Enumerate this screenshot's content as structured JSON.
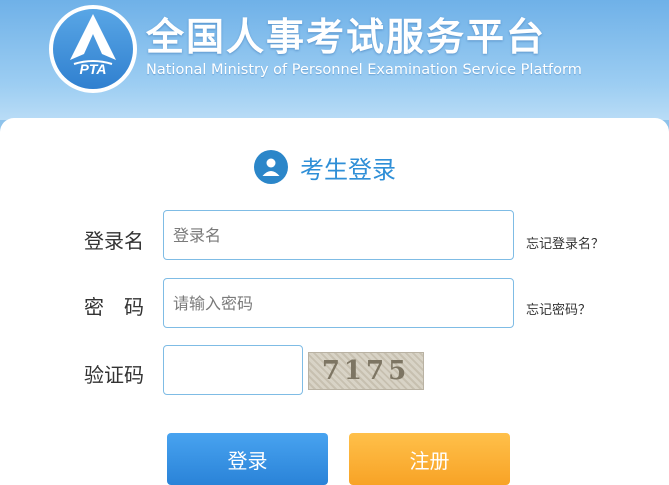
{
  "header": {
    "logo_text": "PTA",
    "title": "全国人事考试服务平台",
    "subtitle": "National Ministry of Personnel Examination Service Platform"
  },
  "panel": {
    "title": "考生登录",
    "title_icon": "user-icon"
  },
  "form": {
    "username": {
      "label": "登录名",
      "placeholder": "登录名",
      "value": "",
      "forgot": "忘记登录名？"
    },
    "password": {
      "label": "密　码",
      "placeholder": "请输入密码",
      "value": "",
      "forgot": "忘记密码？"
    },
    "captcha": {
      "label": "验证码",
      "value": "",
      "image_text": "7175"
    }
  },
  "buttons": {
    "login": "登录",
    "register": "注册"
  },
  "colors": {
    "header_blue": "#6fb1e8",
    "accent_blue": "#2f8fd7",
    "login_button": "#2a83d8",
    "register_button": "#f8a326"
  }
}
